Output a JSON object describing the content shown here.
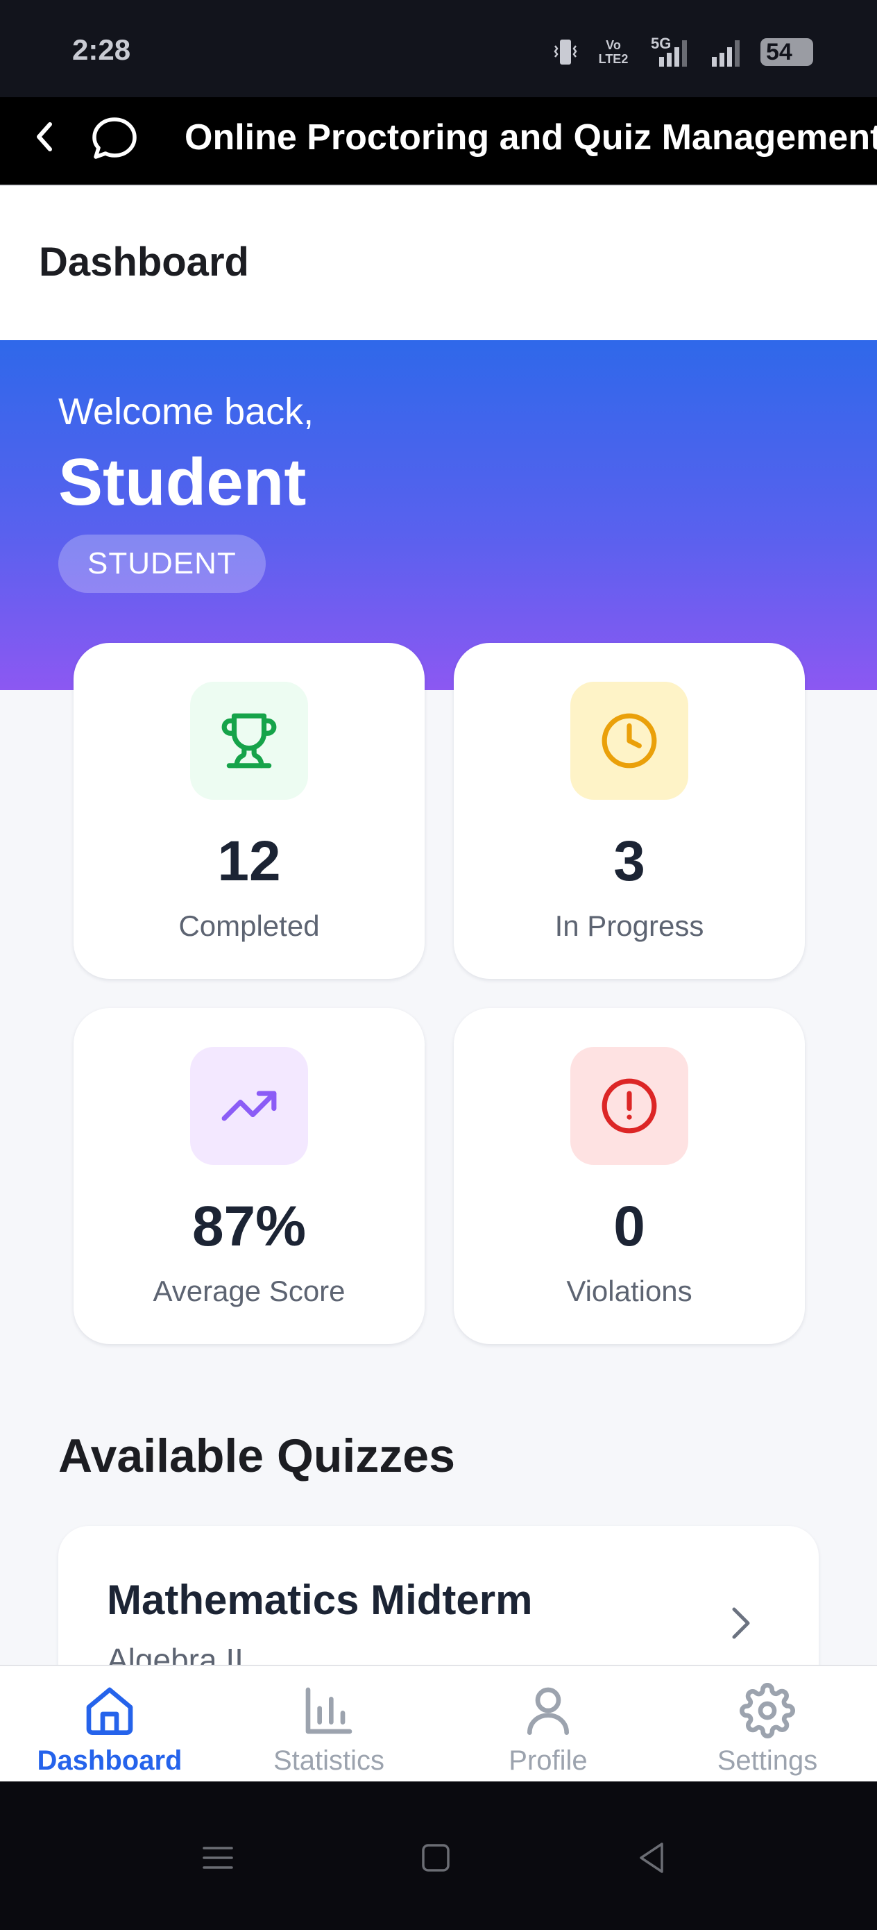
{
  "status_bar": {
    "time": "2:28",
    "network_label": "Vo LTE2",
    "network_gen": "5G",
    "battery": "54"
  },
  "app_bar": {
    "title": "Online Proctoring and Quiz Management"
  },
  "page": {
    "title": "Dashboard"
  },
  "hero": {
    "welcome": "Welcome back,",
    "name": "Student",
    "role": "STUDENT"
  },
  "stats": [
    {
      "value": "12",
      "label": "Completed",
      "icon": "trophy-icon",
      "color": "#16a34a",
      "bg": "#edfcf2"
    },
    {
      "value": "3",
      "label": "In Progress",
      "icon": "clock-icon",
      "color": "#eaa00a",
      "bg": "#fef3c7"
    },
    {
      "value": "87%",
      "label": "Average Score",
      "icon": "trending-up-icon",
      "color": "#8b5cf6",
      "bg": "#f3e8ff"
    },
    {
      "value": "0",
      "label": "Violations",
      "icon": "alert-circle-icon",
      "color": "#dc2626",
      "bg": "#fee2e2"
    }
  ],
  "quizzes": {
    "section_title": "Available Quizzes",
    "items": [
      {
        "title": "Mathematics Midterm",
        "subtitle": "Algebra II"
      }
    ]
  },
  "bottom_nav": {
    "items": [
      {
        "label": "Dashboard",
        "icon": "home-icon",
        "active": true
      },
      {
        "label": "Statistics",
        "icon": "bar-chart-icon",
        "active": false
      },
      {
        "label": "Profile",
        "icon": "user-icon",
        "active": false
      },
      {
        "label": "Settings",
        "icon": "gear-icon",
        "active": false
      }
    ]
  },
  "colors": {
    "accent": "#2563eb",
    "hero_top": "#2f68ea",
    "hero_bottom": "#8c58f2"
  }
}
